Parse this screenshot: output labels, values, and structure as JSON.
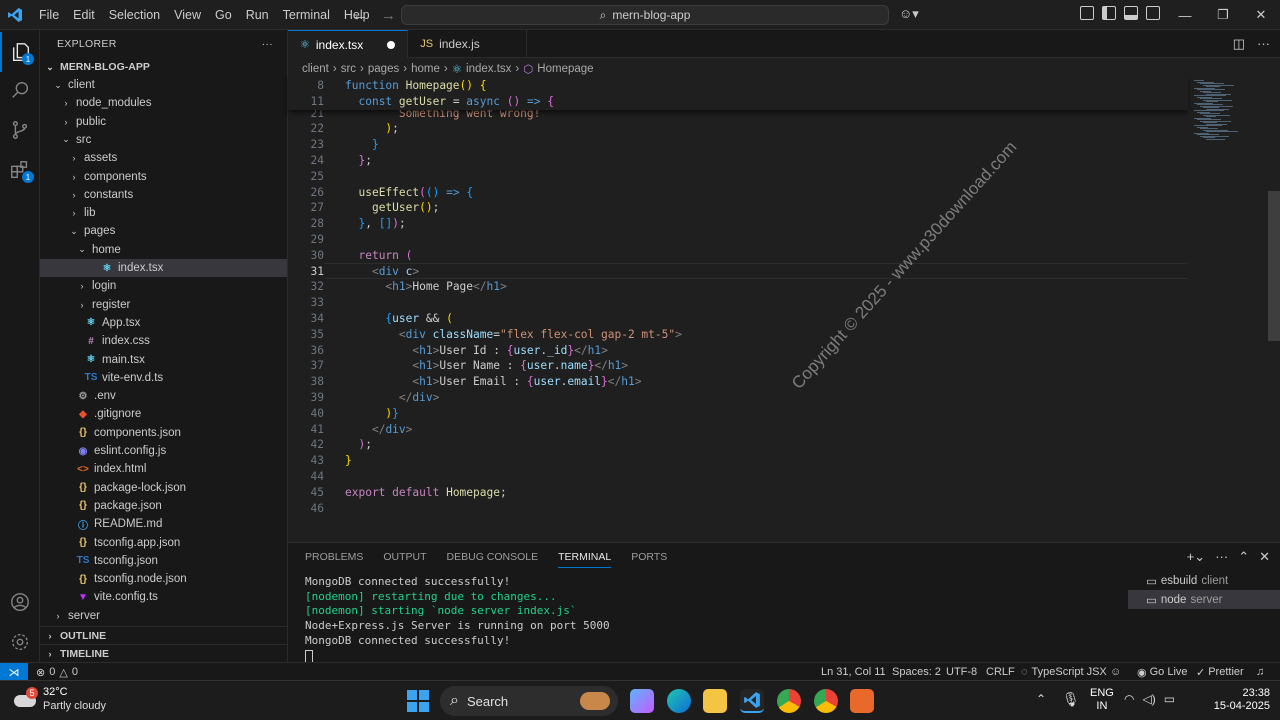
{
  "menu": [
    "File",
    "Edit",
    "Selection",
    "View",
    "Go",
    "Run",
    "Terminal",
    "Help"
  ],
  "search": {
    "text": "mern-blog-app"
  },
  "explorer": {
    "title": "EXPLORER",
    "more": "···",
    "project": "MERN-BLOG-APP"
  },
  "tree": [
    {
      "label": "client",
      "depth": 1,
      "kind": "folder-open"
    },
    {
      "label": "node_modules",
      "depth": 2,
      "kind": "folder"
    },
    {
      "label": "public",
      "depth": 2,
      "kind": "folder"
    },
    {
      "label": "src",
      "depth": 2,
      "kind": "folder-open"
    },
    {
      "label": "assets",
      "depth": 3,
      "kind": "folder"
    },
    {
      "label": "components",
      "depth": 3,
      "kind": "folder"
    },
    {
      "label": "constants",
      "depth": 3,
      "kind": "folder"
    },
    {
      "label": "lib",
      "depth": 3,
      "kind": "folder"
    },
    {
      "label": "pages",
      "depth": 3,
      "kind": "folder-open"
    },
    {
      "label": "home",
      "depth": 4,
      "kind": "folder-open"
    },
    {
      "label": "index.tsx",
      "depth": 5,
      "kind": "react",
      "selected": true
    },
    {
      "label": "login",
      "depth": 4,
      "kind": "folder"
    },
    {
      "label": "register",
      "depth": 4,
      "kind": "folder"
    },
    {
      "label": "App.tsx",
      "depth": 3,
      "kind": "react"
    },
    {
      "label": "index.css",
      "depth": 3,
      "kind": "css"
    },
    {
      "label": "main.tsx",
      "depth": 3,
      "kind": "react"
    },
    {
      "label": "vite-env.d.ts",
      "depth": 3,
      "kind": "ts"
    },
    {
      "label": ".env",
      "depth": 2,
      "kind": "gear"
    },
    {
      "label": ".gitignore",
      "depth": 2,
      "kind": "git"
    },
    {
      "label": "components.json",
      "depth": 2,
      "kind": "json"
    },
    {
      "label": "eslint.config.js",
      "depth": 2,
      "kind": "eslint"
    },
    {
      "label": "index.html",
      "depth": 2,
      "kind": "html"
    },
    {
      "label": "package-lock.json",
      "depth": 2,
      "kind": "json"
    },
    {
      "label": "package.json",
      "depth": 2,
      "kind": "json"
    },
    {
      "label": "README.md",
      "depth": 2,
      "kind": "info"
    },
    {
      "label": "tsconfig.app.json",
      "depth": 2,
      "kind": "json"
    },
    {
      "label": "tsconfig.json",
      "depth": 2,
      "kind": "tsconfig"
    },
    {
      "label": "tsconfig.node.json",
      "depth": 2,
      "kind": "json"
    },
    {
      "label": "vite.config.ts",
      "depth": 2,
      "kind": "vite"
    },
    {
      "label": "server",
      "depth": 1,
      "kind": "folder"
    }
  ],
  "outline": "OUTLINE",
  "timeline": "TIMELINE",
  "tabs": [
    {
      "label": "index.tsx",
      "active": true,
      "dirty": true
    },
    {
      "label": "index.js",
      "active": false,
      "dirty": false
    }
  ],
  "breadcrumb": [
    "client",
    "src",
    "pages",
    "home",
    "index.tsx",
    "Homepage"
  ],
  "code_lines": [
    {
      "n": "8",
      "html": "<span class='kw'>function</span> <span class='fn'>Homepage</span><span class='br'>()</span> <span class='br'>{</span>"
    },
    {
      "n": "11",
      "html": "  <span class='kw'>const</span> <span class='fn'>getUser</span> = <span class='kw'>async</span> <span class='br2'>()</span> <span class='kw'>=&gt;</span> <span class='br2'>{</span>"
    },
    {
      "n": "21",
      "html": "        <span class='str'>Something went wrong!</span>"
    },
    {
      "n": "22",
      "html": "      <span class='br'>)</span>;"
    },
    {
      "n": "23",
      "html": "    <span class='br3'>}</span>"
    },
    {
      "n": "24",
      "html": "  <span class='br2'>}</span>;"
    },
    {
      "n": "25",
      "html": ""
    },
    {
      "n": "26",
      "html": "  <span class='fn'>useEffect</span><span class='br2'>(</span><span class='br3'>()</span> <span class='kw'>=&gt;</span> <span class='br3'>{</span>"
    },
    {
      "n": "27",
      "html": "    <span class='fn'>getUser</span><span class='br'>()</span>;"
    },
    {
      "n": "28",
      "html": "  <span class='br3'>}</span>, <span class='br3'>[]</span><span class='br2'>)</span>;"
    },
    {
      "n": "29",
      "html": ""
    },
    {
      "n": "30",
      "html": "  <span class='ctl'>return</span> <span class='br2'>(</span>"
    },
    {
      "n": "31",
      "html": "    <span class='pun'>&lt;</span><span class='tag'>div</span> <span class='attr'>c</span><span class='pun'>&gt;</span>"
    },
    {
      "n": "32",
      "html": "      <span class='pun'>&lt;</span><span class='tag'>h1</span><span class='pun'>&gt;</span><span class='txt'>Home Page</span><span class='pun'>&lt;/</span><span class='tag'>h1</span><span class='pun'>&gt;</span>"
    },
    {
      "n": "33",
      "html": ""
    },
    {
      "n": "34",
      "html": "      <span class='br3'>{</span><span class='vr'>user</span> &amp;&amp; <span class='br'>(</span>"
    },
    {
      "n": "35",
      "html": "        <span class='pun'>&lt;</span><span class='tag'>div</span> <span class='attr'>className</span>=<span class='str'>\"flex flex-col gap-2 mt-5\"</span><span class='pun'>&gt;</span>"
    },
    {
      "n": "36",
      "html": "          <span class='pun'>&lt;</span><span class='tag'>h1</span><span class='pun'>&gt;</span><span class='txt'>User Id : </span><span class='br2'>{</span><span class='vr'>user</span>.<span class='vr'>_id</span><span class='br2'>}</span><span class='pun'>&lt;/</span><span class='tag'>h1</span><span class='pun'>&gt;</span>"
    },
    {
      "n": "37",
      "html": "          <span class='pun'>&lt;</span><span class='tag'>h1</span><span class='pun'>&gt;</span><span class='txt'>User Name : </span><span class='br2'>{</span><span class='vr'>user</span>.<span class='vr'>name</span><span class='br2'>}</span><span class='pun'>&lt;/</span><span class='tag'>h1</span><span class='pun'>&gt;</span>"
    },
    {
      "n": "38",
      "html": "          <span class='pun'>&lt;</span><span class='tag'>h1</span><span class='pun'>&gt;</span><span class='txt'>User Email : </span><span class='br2'>{</span><span class='vr'>user</span>.<span class='vr'>email</span><span class='br2'>}</span><span class='pun'>&lt;/</span><span class='tag'>h1</span><span class='pun'>&gt;</span>"
    },
    {
      "n": "39",
      "html": "        <span class='pun'>&lt;/</span><span class='tag'>div</span><span class='pun'>&gt;</span>"
    },
    {
      "n": "40",
      "html": "      <span class='br'>)</span><span class='br3'>}</span>"
    },
    {
      "n": "41",
      "html": "    <span class='pun'>&lt;/</span><span class='tag'>div</span><span class='pun'>&gt;</span>"
    },
    {
      "n": "42",
      "html": "  <span class='br2'>)</span>;"
    },
    {
      "n": "43",
      "html": "<span class='br'>}</span>"
    },
    {
      "n": "44",
      "html": ""
    },
    {
      "n": "45",
      "html": "<span class='ctl'>export</span> <span class='ctl'>default</span> <span class='fn'>Homepage</span>;"
    },
    {
      "n": "46",
      "html": ""
    }
  ],
  "current_line": "31",
  "watermark": "Copyright © 2025 - www.p30download.com",
  "panel_tabs": [
    "PROBLEMS",
    "OUTPUT",
    "DEBUG CONSOLE",
    "TERMINAL",
    "PORTS"
  ],
  "terminal_lines": [
    {
      "text": "MongoDB connected successfully!",
      "color": "#cccccc"
    },
    {
      "text": "[nodemon] restarting due to changes...",
      "color": "#23d18b"
    },
    {
      "text": "[nodemon] starting `node server index.js`",
      "color": "#23d18b"
    },
    {
      "text": "Node+Express.js Server is running on port 5000",
      "color": "#cccccc"
    },
    {
      "text": "MongoDB connected successfully!",
      "color": "#cccccc"
    }
  ],
  "terminals": [
    {
      "name": "esbuild",
      "sub": "client",
      "selected": false
    },
    {
      "name": "node",
      "sub": "server",
      "selected": true
    }
  ],
  "status": {
    "errors": "0",
    "warnings": "0",
    "position": "Ln 31, Col 11",
    "spaces": "Spaces: 2",
    "encoding": "UTF-8",
    "eol": "CRLF",
    "language": "TypeScript JSX",
    "golive": "Go Live",
    "prettier": "Prettier"
  },
  "taskbar": {
    "temp": "32°C",
    "weather": "Partly cloudy",
    "search": "Search",
    "lang1": "ENG",
    "lang2": "IN",
    "time": "23:38",
    "date": "15-04-2025",
    "weather_badge": "5"
  }
}
